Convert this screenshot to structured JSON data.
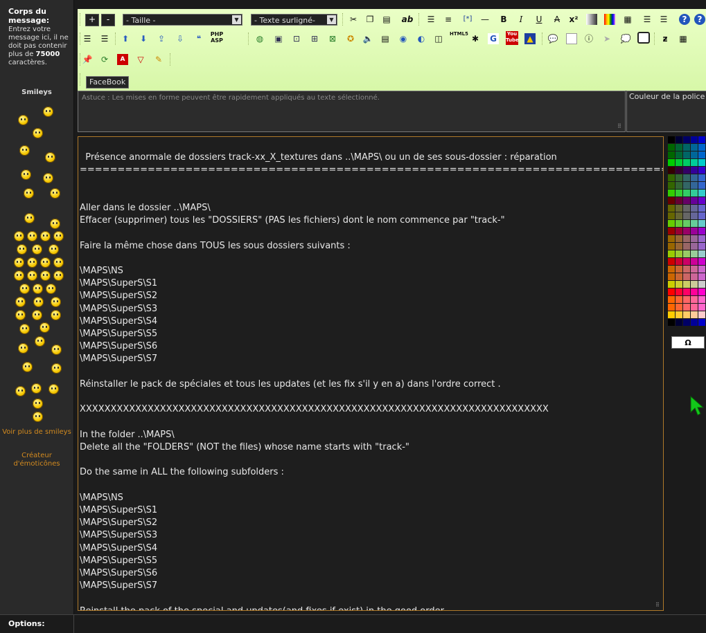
{
  "sidebar": {
    "title": "Corps du message:",
    "desc_prefix": "Entrez votre message ici, il ne doit pas contenir plus de",
    "desc_limit": "75000",
    "desc_suffix": "caractères.",
    "smileys_title": "Smileys",
    "more_smileys": "Voir plus de smileys",
    "emoticon_creator": "Créateur d'émoticônes"
  },
  "toolbar": {
    "plus_label": "+",
    "minus_label": "-",
    "size_select": "- Taille -",
    "highlight_select": "- Texte surligné-",
    "facebook_label": "FaceBook",
    "bold": "B",
    "italic": "I",
    "underline": "U",
    "strike": "A",
    "superscript": "x²",
    "code_label": "[*]",
    "php_asp": "PHP ASP",
    "html5": "HTML5",
    "youtube": "You Tube",
    "google": "G"
  },
  "astuce": "Astuce : Les mises en forme peuvent être rapidement appliqués au texte sélectionné.",
  "couleur_label": "Couleur de la police",
  "omega_label": "Ω",
  "options_label": "Options:",
  "editor_text": "Présence anormale de dossiers track-xx_X_textures dans ..\\MAPS\\ ou un de ses sous-dossier : réparation\n================================================================================\n\n\nAller dans le dossier ..\\MAPS\\\nEffacer (supprimer) tous les \"DOSSIERS\" (PAS les fichiers) dont le nom commence par \"track-\"\n\nFaire la même chose dans TOUS les sous dossiers suivants :\n\n\\MAPS\\NS\n\\MAPS\\SuperS\\S1\n\\MAPS\\SuperS\\S2\n\\MAPS\\SuperS\\S3\n\\MAPS\\SuperS\\S4\n\\MAPS\\SuperS\\S5\n\\MAPS\\SuperS\\S6\n\\MAPS\\SuperS\\S7\n\nRéinstaller le pack de spéciales et tous les updates (et les fix s'il y en a) dans l'ordre correct .\n\nXXXXXXXXXXXXXXXXXXXXXXXXXXXXXXXXXXXXXXXXXXXXXXXXXXXXXXXXXXXXXXXXXXXXXXXXXXXX\n\nIn the folder ..\\MAPS\\\nDelete all the \"FOLDERS\" (NOT the files) whose name starts with \"track-\"\n\nDo the same in ALL the following subfolders :\n\n\\MAPS\\NS\n\\MAPS\\SuperS\\S1\n\\MAPS\\SuperS\\S2\n\\MAPS\\SuperS\\S3\n\\MAPS\\SuperS\\S4\n\\MAPS\\SuperS\\S5\n\\MAPS\\SuperS\\S6\n\\MAPS\\SuperS\\S7\n\nReinstall the pack of the special and updates(and fixes if exist) in the good order ."
}
